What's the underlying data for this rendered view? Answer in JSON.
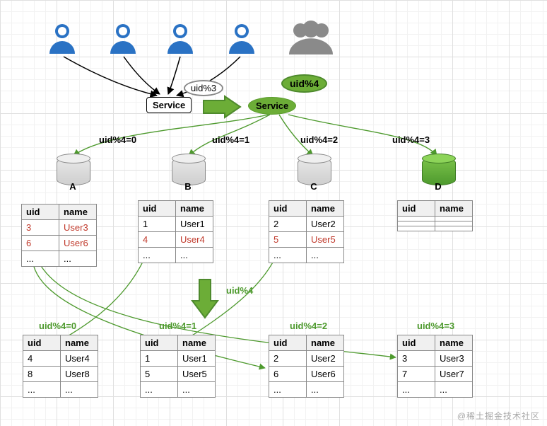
{
  "service1": {
    "label": "Service",
    "bubble": "uid%3"
  },
  "service2": {
    "label": "Service",
    "bubble": "uid%4"
  },
  "edges_from_service2": {
    "e0": "uid%4=0",
    "e1": "uid%4=1",
    "e2": "uid%4=2",
    "e3": "uid%4=3"
  },
  "dbs": {
    "a": "A",
    "b": "B",
    "c": "C",
    "d": "D"
  },
  "cols": {
    "uid": "uid",
    "name": "name"
  },
  "topTables": {
    "A": [
      [
        "3",
        "User3",
        true
      ],
      [
        "6",
        "User6",
        true
      ],
      [
        "...",
        "...",
        false
      ]
    ],
    "B": [
      [
        "1",
        "User1",
        false
      ],
      [
        "4",
        "User4",
        true
      ],
      [
        "...",
        "...",
        false
      ]
    ],
    "C": [
      [
        "2",
        "User2",
        false
      ],
      [
        "5",
        "User5",
        true
      ],
      [
        "...",
        "...",
        false
      ]
    ],
    "D": [
      [
        "",
        "",
        false
      ],
      [
        "",
        "",
        false
      ],
      [
        "",
        "",
        false
      ]
    ]
  },
  "midArrowLabel": "uid%4",
  "bottomEdges": {
    "e0": "uid%4=0",
    "e1": "uid%4=1",
    "e2": "uid%4=2",
    "e3": "uid%4=3"
  },
  "bottomTables": {
    "0": [
      [
        "4",
        "User4"
      ],
      [
        "8",
        "User8"
      ],
      [
        "...",
        "..."
      ]
    ],
    "1": [
      [
        "1",
        "User1"
      ],
      [
        "5",
        "User5"
      ],
      [
        "...",
        "..."
      ]
    ],
    "2": [
      [
        "2",
        "User2"
      ],
      [
        "6",
        "User6"
      ],
      [
        "...",
        "..."
      ]
    ],
    "3": [
      [
        "3",
        "User3"
      ],
      [
        "7",
        "User7"
      ],
      [
        "...",
        "..."
      ]
    ]
  },
  "watermark": "@稀土掘金技术社区",
  "chart_data": {
    "type": "diagram",
    "title": "Database sharding migration from uid%3 to uid%4",
    "before": {
      "hash": "uid%3",
      "shards": [
        "A",
        "B",
        "C"
      ],
      "rows": {
        "A": [
          {
            "uid": 3,
            "name": "User3"
          },
          {
            "uid": 6,
            "name": "User6"
          }
        ],
        "B": [
          {
            "uid": 1,
            "name": "User1"
          },
          {
            "uid": 4,
            "name": "User4"
          }
        ],
        "C": [
          {
            "uid": 2,
            "name": "User2"
          },
          {
            "uid": 5,
            "name": "User5"
          }
        ]
      }
    },
    "after": {
      "hash": "uid%4",
      "shards": [
        "A",
        "B",
        "C",
        "D"
      ],
      "routes": {
        "A": "uid%4=0",
        "B": "uid%4=1",
        "C": "uid%4=2",
        "D": "uid%4=3"
      },
      "rows": {
        "0": [
          {
            "uid": 4,
            "name": "User4"
          },
          {
            "uid": 8,
            "name": "User8"
          }
        ],
        "1": [
          {
            "uid": 1,
            "name": "User1"
          },
          {
            "uid": 5,
            "name": "User5"
          }
        ],
        "2": [
          {
            "uid": 2,
            "name": "User2"
          },
          {
            "uid": 6,
            "name": "User6"
          }
        ],
        "3": [
          {
            "uid": 3,
            "name": "User3"
          },
          {
            "uid": 7,
            "name": "User7"
          }
        ]
      },
      "moved_rows_highlighted_in_red": [
        {
          "uid": 3
        },
        {
          "uid": 6
        },
        {
          "uid": 4
        },
        {
          "uid": 5
        }
      ]
    }
  }
}
